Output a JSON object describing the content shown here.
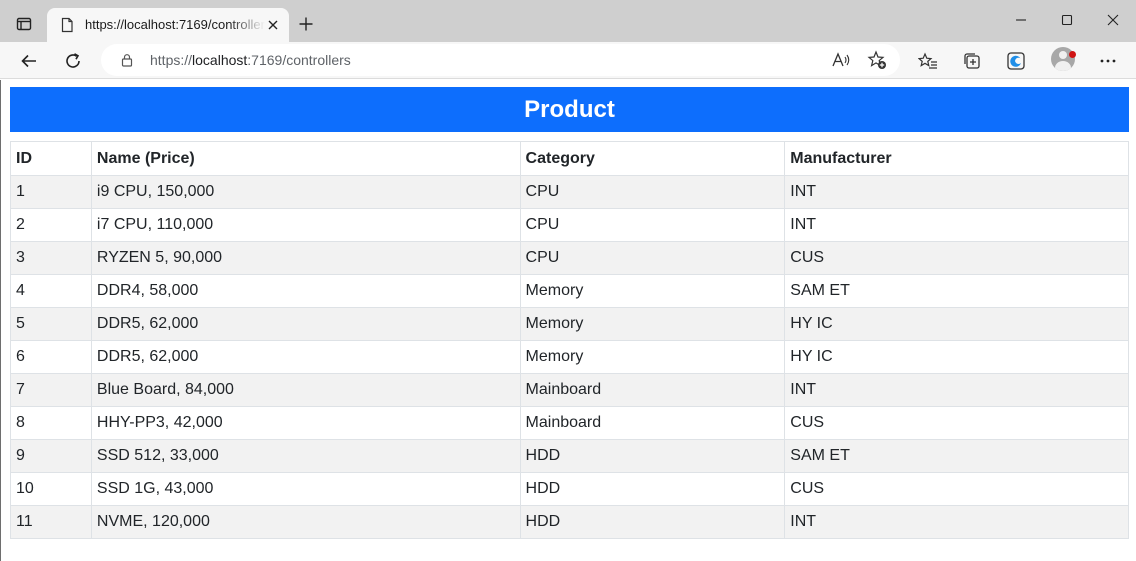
{
  "browser": {
    "tab": {
      "title": "https://localhost:7169/controllers"
    },
    "address_bar": {
      "scheme": "https://",
      "host": "localhost",
      "rest": ":7169/controllers"
    }
  },
  "page": {
    "heading": "Product",
    "table": {
      "headers": [
        "ID",
        "Name (Price)",
        "Category",
        "Manufacturer"
      ],
      "rows": [
        [
          "1",
          "i9 CPU, 150,000",
          "CPU",
          "INT"
        ],
        [
          "2",
          "i7 CPU, 110,000",
          "CPU",
          "INT"
        ],
        [
          "3",
          "RYZEN 5, 90,000",
          "CPU",
          "CUS"
        ],
        [
          "4",
          "DDR4, 58,000",
          "Memory",
          "SAM ET"
        ],
        [
          "5",
          "DDR5, 62,000",
          "Memory",
          "HY IC"
        ],
        [
          "6",
          "DDR5, 62,000",
          "Memory",
          "HY IC"
        ],
        [
          "7",
          "Blue Board, 84,000",
          "Mainboard",
          "INT"
        ],
        [
          "8",
          "HHY-PP3, 42,000",
          "Mainboard",
          "CUS"
        ],
        [
          "9",
          "SSD 512, 33,000",
          "HDD",
          "SAM ET"
        ],
        [
          "10",
          "SSD 1G, 43,000",
          "HDD",
          "CUS"
        ],
        [
          "11",
          "NVME, 120,000",
          "HDD",
          "INT"
        ]
      ]
    }
  },
  "colors": {
    "banner": "#0d6efd",
    "row_stripe": "#f2f2f2",
    "tab_strip": "#cfcfcf"
  },
  "icons": [
    "tab-actions-icon",
    "page-favicon-icon",
    "close-icon",
    "plus-icon",
    "minimize-icon",
    "maximize-icon",
    "window-close-icon",
    "back-arrow-icon",
    "refresh-icon",
    "lock-icon",
    "read-aloud-icon",
    "add-favorite-icon",
    "favorites-icon",
    "collections-icon",
    "edge-icon",
    "more-icon"
  ]
}
